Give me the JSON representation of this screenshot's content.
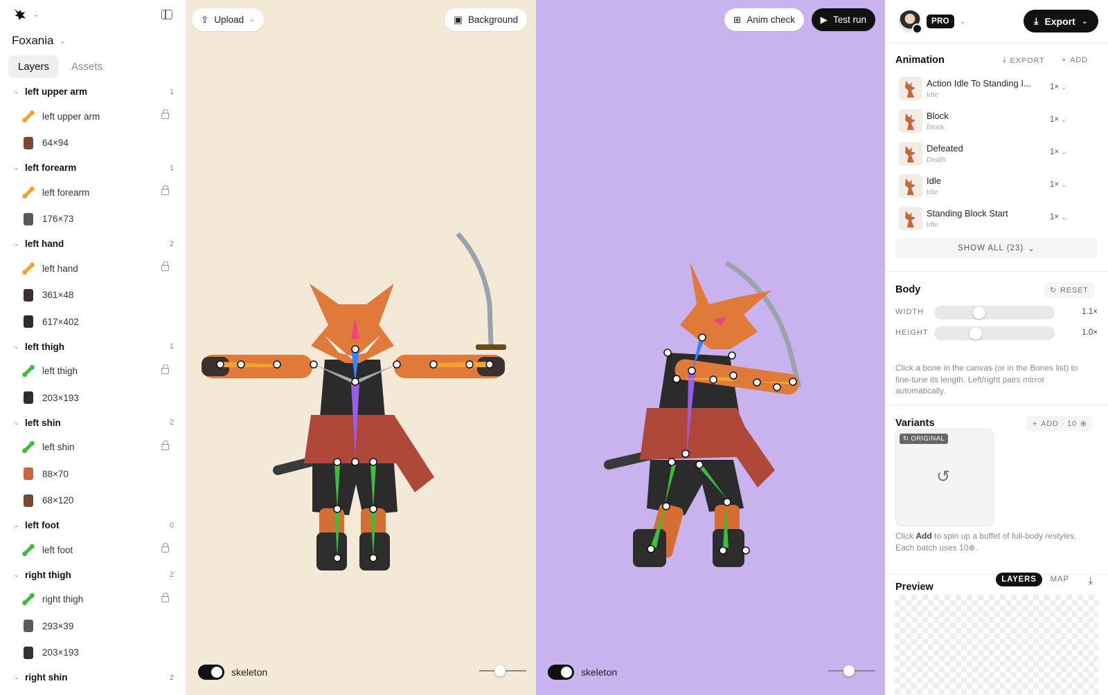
{
  "project": {
    "name": "Foxania"
  },
  "tabs": [
    {
      "label": "Layers"
    },
    {
      "label": "Assets"
    }
  ],
  "layers": [
    {
      "name": "left upper arm",
      "count": "1",
      "items": [
        {
          "label": "left upper arm",
          "kind": "bone-orange",
          "locked": true
        },
        {
          "label": "64×94",
          "kind": "thumb"
        }
      ]
    },
    {
      "name": "left forearm",
      "count": "1",
      "items": [
        {
          "label": "left forearm",
          "kind": "bone-orange",
          "locked": true
        },
        {
          "label": "176×73",
          "kind": "thumb"
        }
      ]
    },
    {
      "name": "left hand",
      "count": "2",
      "items": [
        {
          "label": "left hand",
          "kind": "bone-orange",
          "locked": true
        },
        {
          "label": "361×48",
          "kind": "thumb"
        },
        {
          "label": "617×402",
          "kind": "thumb"
        }
      ]
    },
    {
      "name": "left thigh",
      "count": "1",
      "items": [
        {
          "label": "left thigh",
          "kind": "bone-green",
          "locked": true
        },
        {
          "label": "203×193",
          "kind": "thumb"
        }
      ]
    },
    {
      "name": "left shin",
      "count": "2",
      "items": [
        {
          "label": "left shin",
          "kind": "bone-green",
          "locked": true
        },
        {
          "label": "88×70",
          "kind": "thumb"
        },
        {
          "label": "68×120",
          "kind": "thumb"
        }
      ]
    },
    {
      "name": "left foot",
      "count": "0",
      "items": [
        {
          "label": "left foot",
          "kind": "bone-green",
          "locked": true
        }
      ]
    },
    {
      "name": "right thigh",
      "count": "2",
      "items": [
        {
          "label": "right thigh",
          "kind": "bone-green",
          "locked": true
        },
        {
          "label": "293×39",
          "kind": "thumb"
        },
        {
          "label": "203×193",
          "kind": "thumb"
        }
      ]
    },
    {
      "name": "right shin",
      "count": "2",
      "items": []
    }
  ],
  "canvas_left": {
    "upload_label": "Upload",
    "background_label": "Background",
    "skeleton_label": "skeleton",
    "skeleton_on": true,
    "color": "#f3e9d6"
  },
  "canvas_right": {
    "anim_check_label": "Anim check",
    "test_run_label": "Test run",
    "skeleton_label": "skeleton",
    "skeleton_on": true,
    "color": "#c9b3ee"
  },
  "header": {
    "plan_badge": "PRO",
    "export_label": "Export"
  },
  "animation": {
    "title": "Animation",
    "export_label": "EXPORT",
    "add_label": "ADD",
    "items": [
      {
        "name": "Action Idle To Standing I...",
        "sub": "Idle",
        "speed": "1×"
      },
      {
        "name": "Block",
        "sub": "Block",
        "speed": "1×"
      },
      {
        "name": "Defeated",
        "sub": "Death",
        "speed": "1×"
      },
      {
        "name": "Idle",
        "sub": "Idle",
        "speed": "1×"
      },
      {
        "name": "Standing Block Start",
        "sub": "Idle",
        "speed": "1×"
      }
    ],
    "show_all_label": "SHOW ALL (23)"
  },
  "body": {
    "title": "Body",
    "reset_label": "RESET",
    "width_label": "WIDTH",
    "width_value": "1.1×",
    "height_label": "HEIGHT",
    "height_value": "1.0×",
    "hint": "Click a bone in the canvas (or in the Bones list) to fine-tune its length. Left/right pairs mirror automatically."
  },
  "variants": {
    "title": "Variants",
    "add_label": "ADD · 10",
    "original_tag": "ORIGINAL",
    "hint_pre": "Click ",
    "hint_bold": "Add",
    "hint_post": " to spin up a buffet of full-body restyles. Each batch uses 10"
  },
  "preview": {
    "title": "Preview",
    "layers_label": "LAYERS",
    "map_label": "MAP"
  }
}
